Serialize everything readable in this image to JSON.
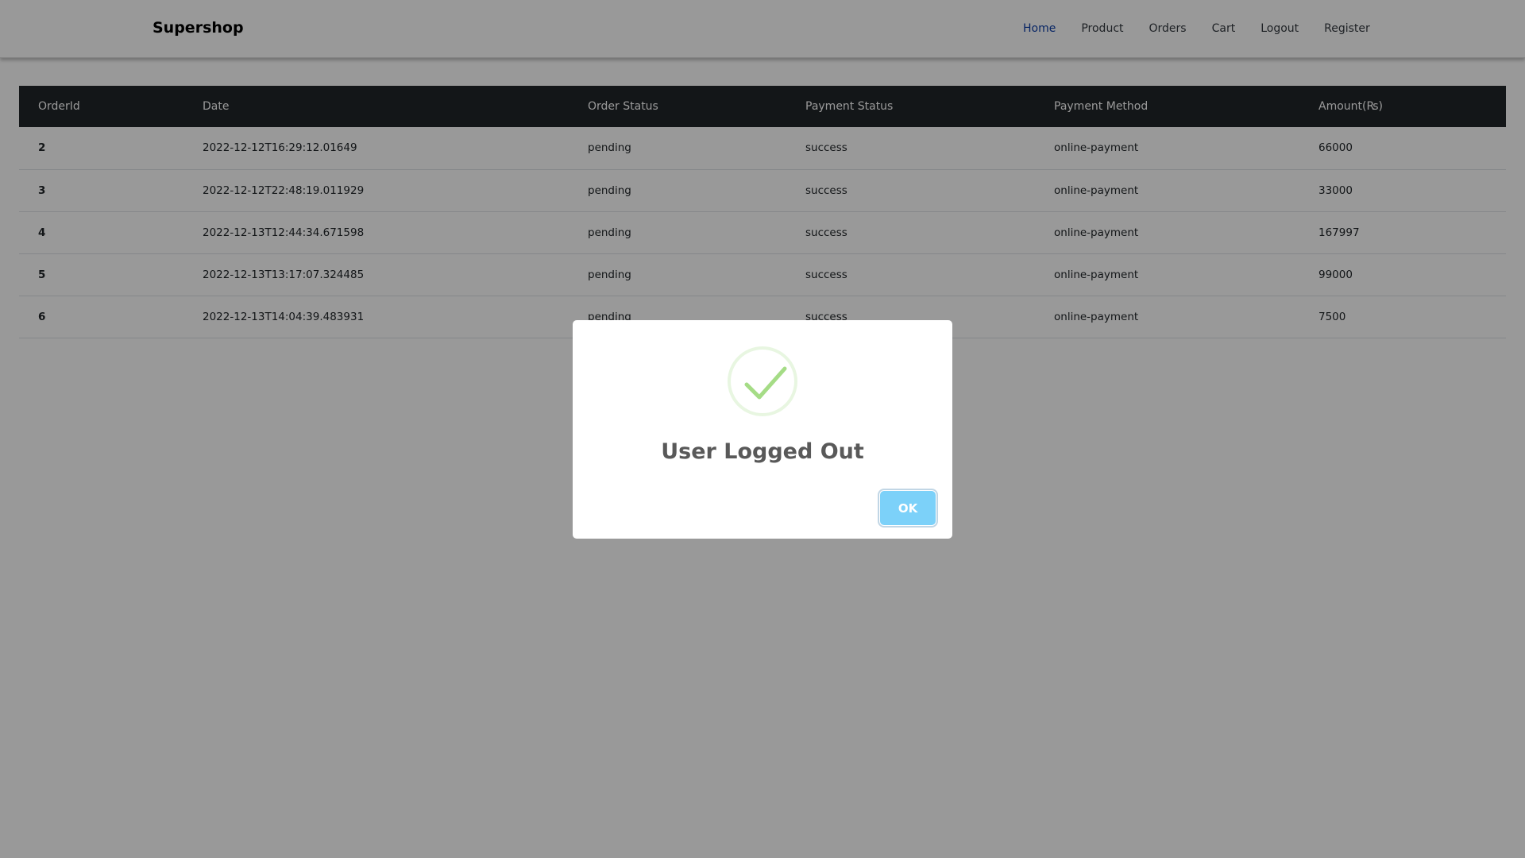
{
  "navbar": {
    "brand": "Supershop",
    "links": [
      "Home",
      "Product",
      "Orders",
      "Cart",
      "Logout",
      "Register"
    ],
    "active": "Home"
  },
  "orders_table": {
    "headers": [
      "OrderId",
      "Date",
      "Order Status",
      "Payment Status",
      "Payment Method",
      "Amount(₨)"
    ],
    "rows": [
      [
        "2",
        "2022-12-12T16:29:12.01649",
        "pending",
        "success",
        "online-payment",
        "66000"
      ],
      [
        "3",
        "2022-12-12T22:48:19.011929",
        "pending",
        "success",
        "online-payment",
        "33000"
      ],
      [
        "4",
        "2022-12-13T12:44:34.671598",
        "pending",
        "success",
        "online-payment",
        "167997"
      ],
      [
        "5",
        "2022-12-13T13:17:07.324485",
        "pending",
        "success",
        "online-payment",
        "99000"
      ],
      [
        "6",
        "2022-12-13T14:04:39.483931",
        "pending",
        "success",
        "online-payment",
        "7500"
      ]
    ]
  },
  "modal": {
    "icon": "check-icon",
    "title": "User Logged Out",
    "ok_label": "OK"
  },
  "colors": {
    "active_link": "#0d3fa8",
    "table_header_bg": "#212529",
    "success_check": "#a5dc86",
    "ok_button": "#7cd1f9"
  }
}
